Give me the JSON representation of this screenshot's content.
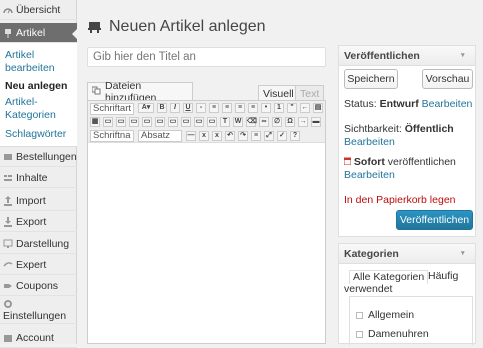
{
  "sidebar": {
    "items": [
      {
        "label": "Übersicht"
      },
      {
        "label": "Artikel"
      },
      {
        "label": "Bestellungen"
      },
      {
        "label": "Inhalte"
      },
      {
        "label": "Import"
      },
      {
        "label": "Export"
      },
      {
        "label": "Darstellung"
      },
      {
        "label": "Expert"
      },
      {
        "label": "Coupons"
      },
      {
        "label": "Einstellungen"
      },
      {
        "label": "Account"
      }
    ],
    "submenu": [
      "Artikel bearbeiten",
      "Neu anlegen",
      "Artikel-Kategorien",
      "Schlagwörter"
    ]
  },
  "page": {
    "title": "Neuen Artikel anlegen"
  },
  "editor": {
    "title_placeholder": "Gib hier den Titel an",
    "add_media": "Dateien hinzufügen",
    "tab_visual": "Visuell",
    "tab_text": "Text",
    "font_select": "Schriftart",
    "size_select": "Schriftna",
    "format_select": "Absatz"
  },
  "publish": {
    "heading": "Veröffentlichen",
    "save": "Speichern",
    "preview": "Vorschau",
    "status_label": "Status:",
    "status_value": "Entwurf",
    "edit": "Bearbeiten",
    "visibility_label": "Sichtbarkeit:",
    "visibility_value": "Öffentlich",
    "schedule_value": "Sofort",
    "schedule_label": "veröffentlichen",
    "trash": "In den Papierkorb legen",
    "publish": "Veröffentlichen"
  },
  "categories": {
    "heading": "Kategorien",
    "tab_all": "Alle Kategorien",
    "tab_common": "Häufig verwendet",
    "items": [
      "Allgemein",
      "Damenuhren"
    ]
  },
  "colors": {
    "accent": "#21759b",
    "trash": "#bc0b0b"
  }
}
